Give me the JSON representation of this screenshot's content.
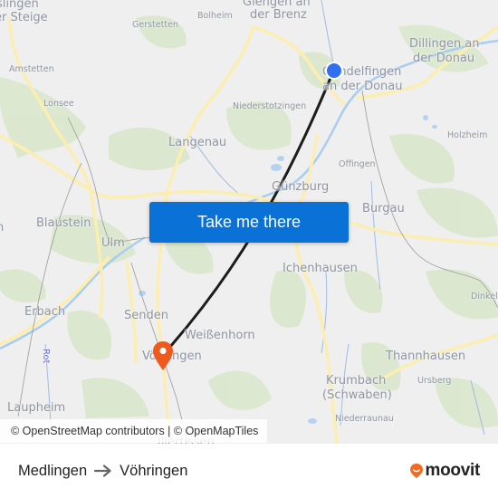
{
  "map": {
    "places": [
      {
        "name": "place-label",
        "text": "slingen",
        "size": "big"
      },
      {
        "name": "place-label",
        "text": "er Steige",
        "size": "big"
      },
      {
        "name": "place-label",
        "text": "Giengen an",
        "size": "big"
      },
      {
        "name": "place-label",
        "text": "der Brenz",
        "size": "big"
      },
      {
        "name": "place-label",
        "text": "Bolheim",
        "size": "small"
      },
      {
        "name": "place-label",
        "text": "Gerstetten",
        "size": "small"
      },
      {
        "name": "place-label",
        "text": "Dillingen an",
        "size": "big"
      },
      {
        "name": "place-label",
        "text": "der Donau",
        "size": "big"
      },
      {
        "name": "place-label",
        "text": "Gundelfingen",
        "size": "big"
      },
      {
        "name": "place-label",
        "text": "an der Donau",
        "size": "big"
      },
      {
        "name": "place-label",
        "text": "Amstetten",
        "size": "small"
      },
      {
        "name": "place-label",
        "text": "Lonsee",
        "size": "small"
      },
      {
        "name": "place-label",
        "text": "Niederstotzingen",
        "size": "small"
      },
      {
        "name": "place-label",
        "text": "Langenau",
        "size": "big"
      },
      {
        "name": "place-label",
        "text": "Holzheim",
        "size": "small"
      },
      {
        "name": "place-label",
        "text": "Offingen",
        "size": "small"
      },
      {
        "name": "place-label",
        "text": "Günzburg",
        "size": "big"
      },
      {
        "name": "place-label",
        "text": "Blaustein",
        "size": "big"
      },
      {
        "name": "place-label",
        "text": "Burgau",
        "size": "big"
      },
      {
        "name": "place-label",
        "text": "Ulm",
        "size": "big"
      },
      {
        "name": "place-label",
        "text": "Ichenhausen",
        "size": "big"
      },
      {
        "name": "place-label",
        "text": "Dinkel",
        "size": "small"
      },
      {
        "name": "place-label",
        "text": "Erbach",
        "size": "big"
      },
      {
        "name": "place-label",
        "text": "Senden",
        "size": "big"
      },
      {
        "name": "place-label",
        "text": "Weißenhorn",
        "size": "big"
      },
      {
        "name": "place-label",
        "text": "Vöhringen",
        "size": "big"
      },
      {
        "name": "place-label",
        "text": "Thannhausen",
        "size": "big"
      },
      {
        "name": "place-label",
        "text": "Krumbach",
        "size": "big"
      },
      {
        "name": "place-label",
        "text": "(Schwaben)",
        "size": "big"
      },
      {
        "name": "place-label",
        "text": "Ursberg",
        "size": "small"
      },
      {
        "name": "place-label",
        "text": "Laupheim",
        "size": "big"
      },
      {
        "name": "place-label",
        "text": "Illertissen",
        "size": "big"
      },
      {
        "name": "place-label",
        "text": "Niederraunau",
        "size": "small"
      },
      {
        "name": "place-label",
        "text": "n",
        "size": "big"
      }
    ],
    "river_label": "Rot",
    "origin_marker": {
      "icon": "origin-dot-icon",
      "color": "#2f6ff0"
    },
    "destination_marker": {
      "icon": "map-pin-icon",
      "color": "#ef5a1c"
    },
    "route_line_color": "#1c1c1c",
    "cta": {
      "label": "Take me there",
      "color": "#0a72d6"
    },
    "attribution": "© OpenStreetMap contributors | © OpenMapTiles"
  },
  "footer": {
    "origin": "Medlingen",
    "arrow_icon": "arrow-right-icon",
    "destination": "Vöhringen",
    "brand": {
      "name": "moovit",
      "icon": "moovit-logo-icon",
      "color": "#f26b21"
    }
  }
}
